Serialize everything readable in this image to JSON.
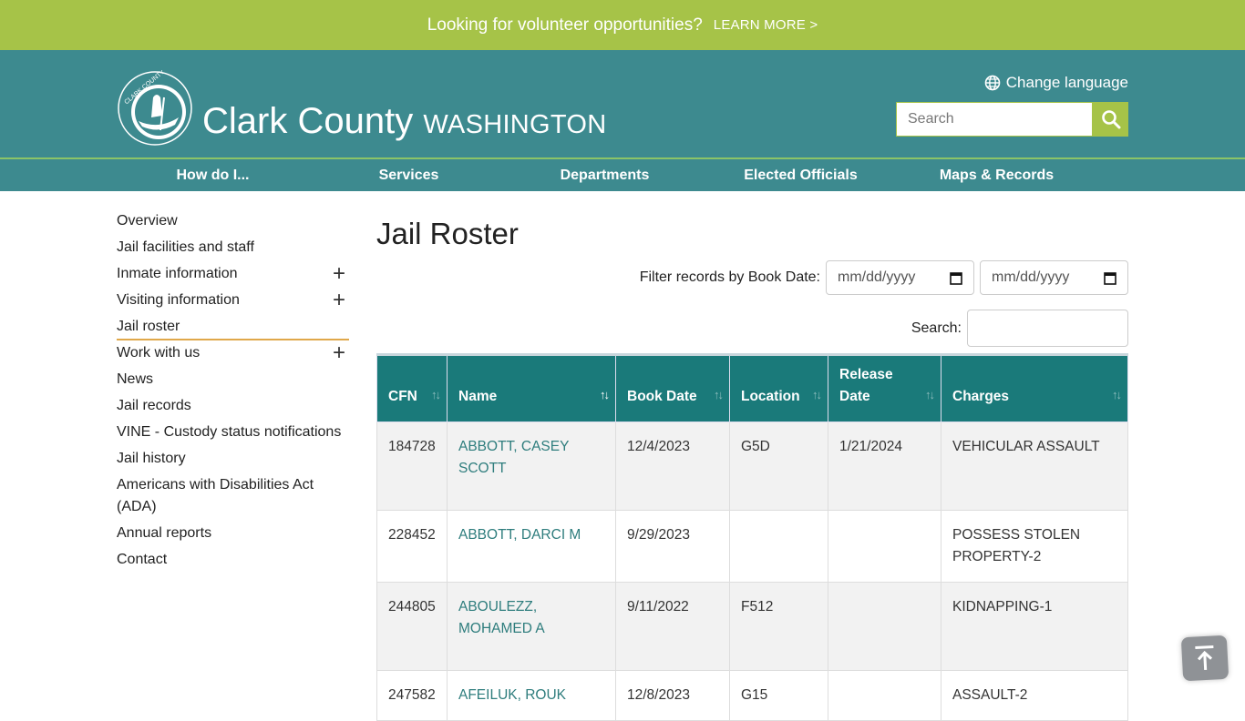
{
  "promo": {
    "message": "Looking for volunteer opportunities?",
    "link": "LEARN MORE >"
  },
  "header": {
    "site_name": "Clark County",
    "site_state": "WASHINGTON",
    "seal_text": "CLARK COUNTY, WASHINGTON",
    "change_language": "Change language",
    "search_placeholder": "Search"
  },
  "nav": [
    "How do I...",
    "Services",
    "Departments",
    "Elected Officials",
    "Maps & Records"
  ],
  "sidebar": {
    "items": [
      {
        "label": "Overview",
        "expandable": false
      },
      {
        "label": "Jail facilities and staff",
        "expandable": false
      },
      {
        "label": "Inmate information",
        "expandable": true
      },
      {
        "label": "Visiting information",
        "expandable": true
      },
      {
        "label": "Jail roster",
        "expandable": false,
        "active": true
      },
      {
        "label": "Work with us",
        "expandable": true
      },
      {
        "label": "News",
        "expandable": false
      },
      {
        "label": "Jail records",
        "expandable": false
      },
      {
        "label": "VINE - Custody status notifications",
        "expandable": false
      },
      {
        "label": "Jail history",
        "expandable": false
      },
      {
        "label": "Americans with Disabilities Act (ADA)",
        "expandable": false
      },
      {
        "label": "Annual reports",
        "expandable": false
      },
      {
        "label": "Contact",
        "expandable": false
      }
    ],
    "expand_symbol": "+"
  },
  "main": {
    "title": "Jail Roster",
    "filter_label": "Filter records by Book Date:",
    "date_from_placeholder": "mm/dd/yyyy",
    "date_to_placeholder": "mm/dd/yyyy",
    "search_label": "Search:",
    "search_value": "",
    "table": {
      "columns": [
        "CFN",
        "Name",
        "Book Date",
        "Location",
        "Release Date",
        "Charges"
      ],
      "sort_icon": "↑↓",
      "sorted_column": "Name",
      "rows": [
        {
          "cfn": "184728",
          "name": "ABBOTT, CASEY SCOTT",
          "book_date": "12/4/2023",
          "location": "G5D",
          "release_date": "1/21/2024",
          "charges": "VEHICULAR ASSAULT"
        },
        {
          "cfn": "228452",
          "name": "ABBOTT, DARCI M",
          "book_date": "9/29/2023",
          "location": "",
          "release_date": "",
          "charges": "POSSESS STOLEN PROPERTY-2"
        },
        {
          "cfn": "244805",
          "name": "ABOULEZZ, MOHAMED A",
          "book_date": "9/11/2022",
          "location": "F512",
          "release_date": "",
          "charges": "KIDNAPPING-1"
        },
        {
          "cfn": "247582",
          "name": "AFEILUK, ROUK",
          "book_date": "12/8/2023",
          "location": "G15",
          "release_date": "",
          "charges": "ASSAULT-2"
        }
      ]
    }
  },
  "colors": {
    "lime": "#a6c348",
    "teal": "#3d8a8f",
    "table_header": "#1a7a7a",
    "active_underline": "#e0a84a",
    "link": "#2e7d7d"
  }
}
